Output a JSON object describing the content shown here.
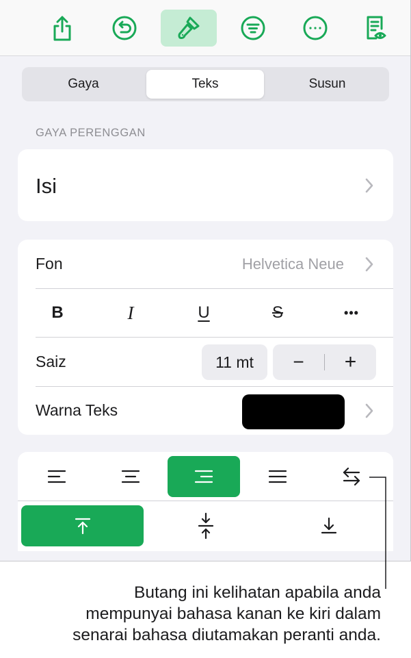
{
  "toolbar": {
    "items": [
      {
        "icon": "share-icon"
      },
      {
        "icon": "undo-icon"
      },
      {
        "icon": "paintbrush-icon",
        "active": true
      },
      {
        "icon": "insert-list-icon"
      },
      {
        "icon": "more-icon"
      },
      {
        "icon": "reading-view-icon"
      }
    ],
    "accent": "#19a957"
  },
  "tabs": [
    {
      "label": "Gaya"
    },
    {
      "label": "Teks",
      "selected": true
    },
    {
      "label": "Susun"
    }
  ],
  "paragraph_style": {
    "section_label": "GAYA PERENGGAN",
    "value": "Isi"
  },
  "font": {
    "label": "Fon",
    "value": "Helvetica Neue"
  },
  "format_buttons": [
    {
      "label": "B",
      "icon": "bold-icon"
    },
    {
      "label": "I",
      "icon": "italic-icon"
    },
    {
      "label": "U",
      "icon": "underline-icon"
    },
    {
      "label": "S",
      "icon": "strikethrough-icon"
    },
    {
      "label": "•••",
      "icon": "more-options-icon"
    }
  ],
  "size": {
    "label": "Saiz",
    "value": "11 mt",
    "decrement": "−",
    "increment": "+"
  },
  "text_color": {
    "label": "Warna Teks",
    "color": "#000000"
  },
  "alignment": {
    "options": [
      "align-left-icon",
      "align-center-icon",
      "align-right-icon",
      "justify-icon",
      "rtl-direction-icon"
    ],
    "selected": "align-right-icon"
  },
  "vertical_alignment": {
    "options": [
      "align-top-icon",
      "align-middle-icon",
      "align-bottom-icon"
    ],
    "selected": "align-top-icon"
  },
  "callout": {
    "lines": [
      "Butang ini kelihatan apabila anda",
      "mempunyai bahasa kanan ke kiri dalam",
      "senarai bahasa diutamakan peranti anda."
    ]
  }
}
